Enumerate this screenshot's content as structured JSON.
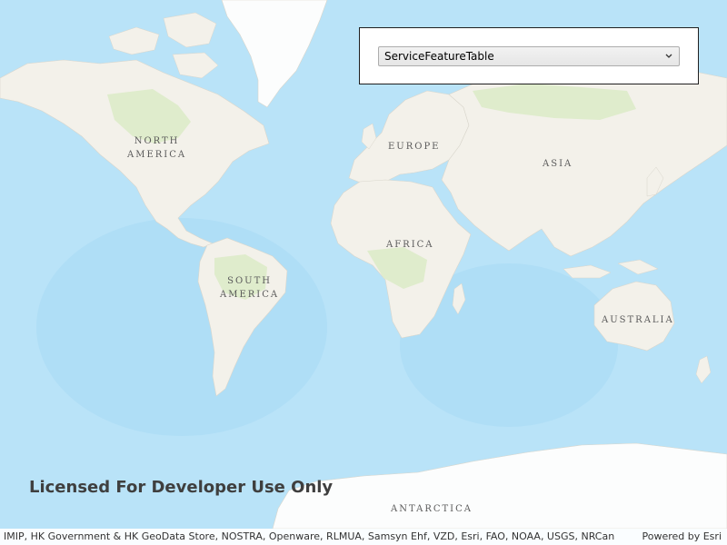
{
  "colors": {
    "ocean": "#b9e3f8",
    "ocean_deep": "#a4d6f2",
    "land": "#f3f1ea",
    "vegetation": "#dfeccc",
    "ice": "#fcfdfd",
    "panel_border": "#1f1f1f"
  },
  "layer_selector": {
    "selected": "ServiceFeatureTable",
    "chevron_icon": "chevron-down-icon"
  },
  "labels": {
    "north_america": "NORTH\nAMERICA",
    "south_america": "SOUTH\nAMERICA",
    "europe": "EUROPE",
    "africa": "AFRICA",
    "asia": "ASIA",
    "australia": "AUSTRALIA",
    "antarctica": "ANTARCTICA"
  },
  "watermark": "Licensed For Developer Use Only",
  "attribution": {
    "sources": "IMIP, HK Government & HK GeoData Store, NOSTRA, Openware, RLMUA, Samsyn Ehf, VZD, Esri, FAO, NOAA, USGS, NRCan",
    "powered_by": "Powered by Esri"
  }
}
